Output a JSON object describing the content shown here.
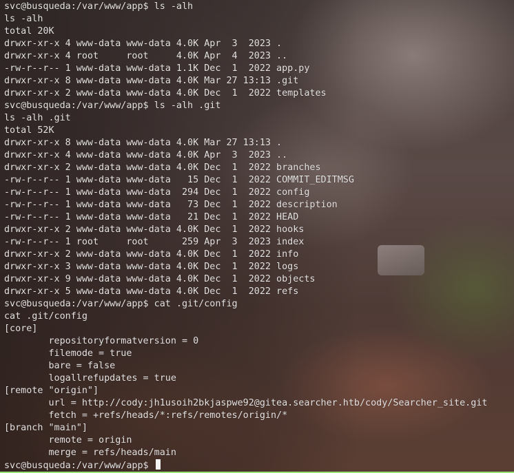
{
  "terminal": {
    "lines": [
      "svc@busqueda:/var/www/app$ ls -alh",
      "ls -alh",
      "total 20K",
      "drwxr-xr-x 4 www-data www-data 4.0K Apr  3  2023 .",
      "drwxr-xr-x 4 root     root     4.0K Apr  4  2023 ..",
      "-rw-r--r-- 1 www-data www-data 1.1K Dec  1  2022 app.py",
      "drwxr-xr-x 8 www-data www-data 4.0K Mar 27 13:13 .git",
      "drwxr-xr-x 2 www-data www-data 4.0K Dec  1  2022 templates",
      "svc@busqueda:/var/www/app$ ls -alh .git",
      "ls -alh .git",
      "total 52K",
      "drwxr-xr-x 8 www-data www-data 4.0K Mar 27 13:13 .",
      "drwxr-xr-x 4 www-data www-data 4.0K Apr  3  2023 ..",
      "drwxr-xr-x 2 www-data www-data 4.0K Dec  1  2022 branches",
      "-rw-r--r-- 1 www-data www-data   15 Dec  1  2022 COMMIT_EDITMSG",
      "-rw-r--r-- 1 www-data www-data  294 Dec  1  2022 config",
      "-rw-r--r-- 1 www-data www-data   73 Dec  1  2022 description",
      "-rw-r--r-- 1 www-data www-data   21 Dec  1  2022 HEAD",
      "drwxr-xr-x 2 www-data www-data 4.0K Dec  1  2022 hooks",
      "-rw-r--r-- 1 root     root      259 Apr  3  2023 index",
      "drwxr-xr-x 2 www-data www-data 4.0K Dec  1  2022 info",
      "drwxr-xr-x 3 www-data www-data 4.0K Dec  1  2022 logs",
      "drwxr-xr-x 9 www-data www-data 4.0K Dec  1  2022 objects",
      "drwxr-xr-x 5 www-data www-data 4.0K Dec  1  2022 refs",
      "svc@busqueda:/var/www/app$ cat .git/config",
      "cat .git/config",
      "[core]",
      "        repositoryformatversion = 0",
      "        filemode = true",
      "        bare = false",
      "        logallrefupdates = true",
      "[remote \"origin\"]",
      "        url = http://cody:jh1usoih2bkjaspwe92@gitea.searcher.htb/cody/Searcher_site.git",
      "        fetch = +refs/heads/*:refs/remotes/origin/*",
      "[branch \"main\"]",
      "        remote = origin",
      "        merge = refs/heads/main"
    ],
    "prompt": "svc@busqueda:/var/www/app$"
  },
  "colors": {
    "text": "#e6e3e3",
    "accent_strip": "#9be17a"
  }
}
